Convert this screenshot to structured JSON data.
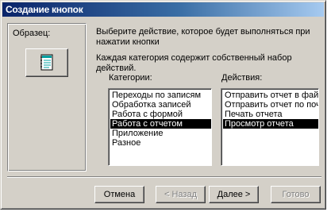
{
  "window": {
    "title": "Создание кнопок"
  },
  "sample": {
    "label": "Образец:",
    "button_icon": "form-icon"
  },
  "description": {
    "line1": "Выберите действие, которое будет выполняться при нажатии кнопки",
    "line2": "Каждая категория содержит собственный набор действий."
  },
  "categories": {
    "label": "Категории:",
    "items": [
      "Переходы по записям",
      "Обработка записей",
      "Работа с формой",
      "Работа с отчетом",
      "Приложение",
      "Разное"
    ],
    "selected_index": 3
  },
  "actions": {
    "label": "Действия:",
    "items": [
      "Отправить отчет в файл",
      "Отправить отчет по почте",
      "Печать отчета",
      "Просмотр отчета"
    ],
    "selected_index": 3
  },
  "buttons": {
    "cancel": "Отмена",
    "back": "< Назад",
    "next": "Далее >",
    "finish": "Готово"
  },
  "colors": {
    "dialog_face": "#d4d0c8",
    "titlebar_start": "#0a246a",
    "titlebar_end": "#a6caf0",
    "selection": "#000000"
  }
}
